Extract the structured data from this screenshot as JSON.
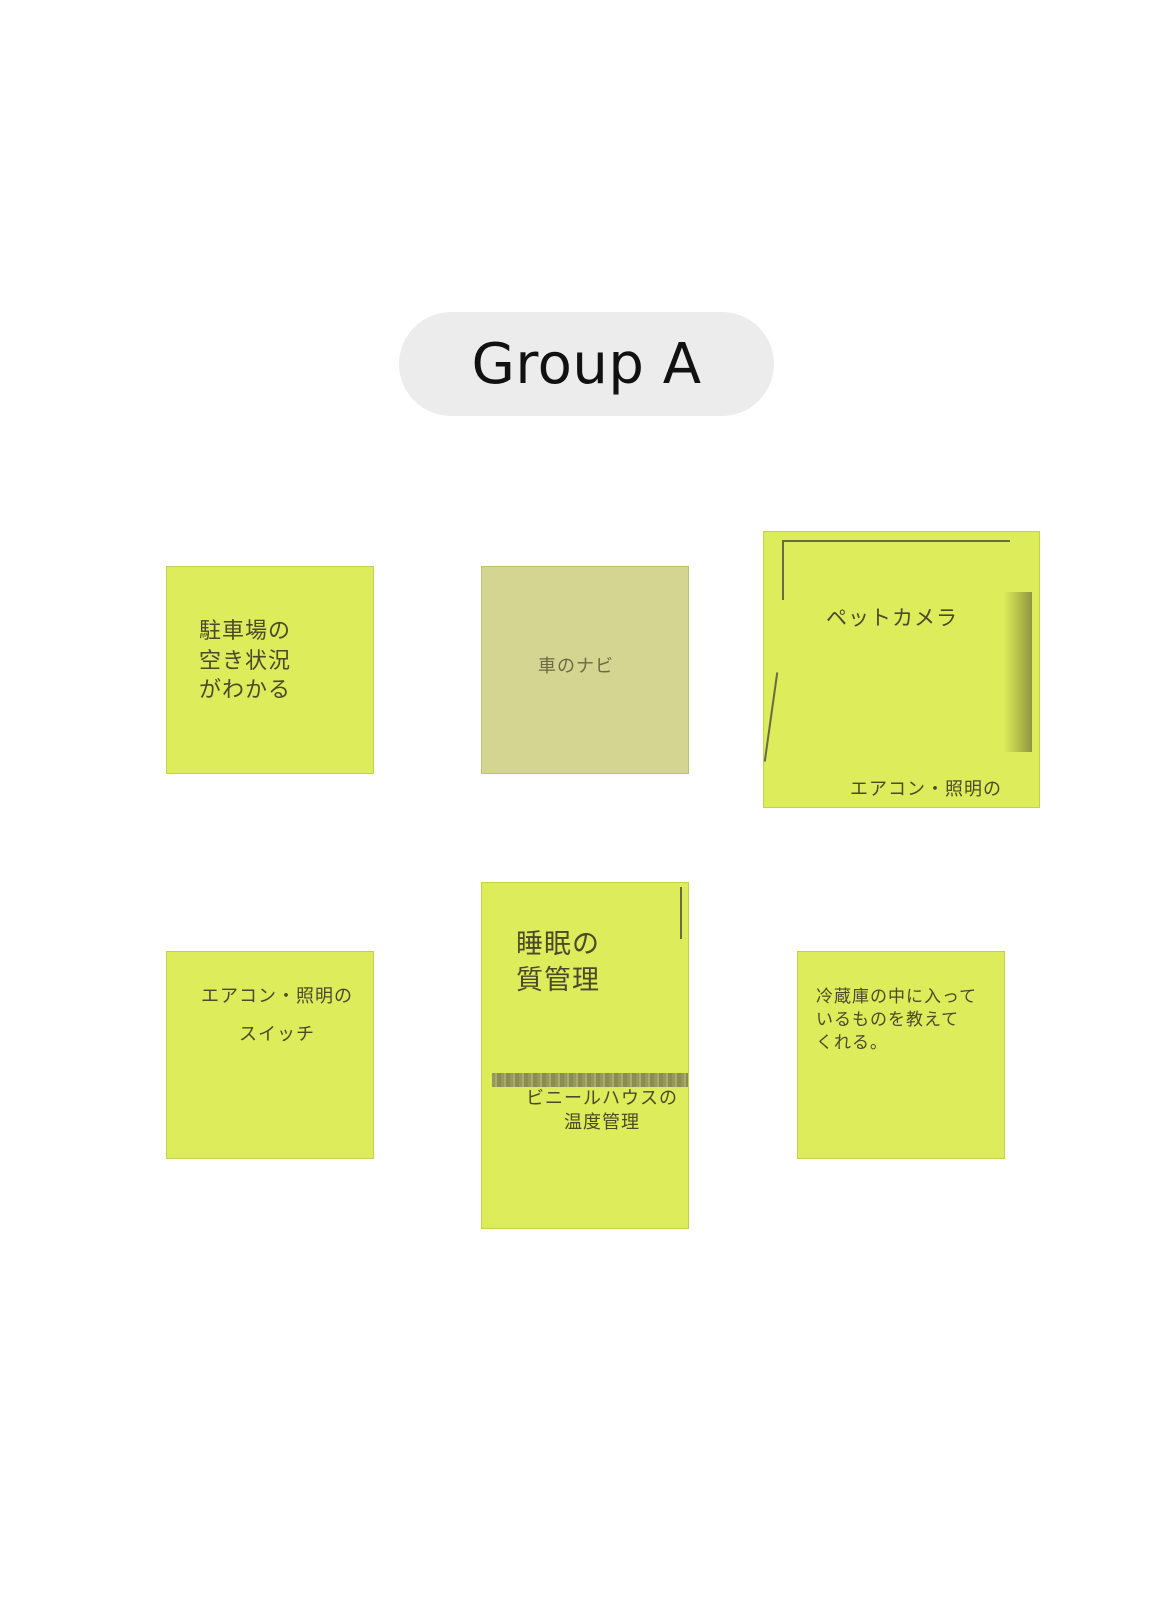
{
  "group": {
    "label": "Group A"
  },
  "notes": [
    {
      "text": "駐車場の\n空き状況\nがわかる"
    },
    {
      "text": "車のナビ"
    },
    {
      "text": "ペットカメラ",
      "footer": "エアコン・照明の"
    },
    {
      "text": "エアコン・照明の\nスイッチ"
    },
    {
      "text": "睡眠の\n質管理",
      "footer": "ビニールハウスの\n温度管理"
    },
    {
      "text": "冷蔵庫の中に入って\nいるものを教えて\nくれる。"
    }
  ],
  "colors": {
    "note": "#dcec5a",
    "note_muted": "#d5d592",
    "label_bg": "#ececec"
  }
}
